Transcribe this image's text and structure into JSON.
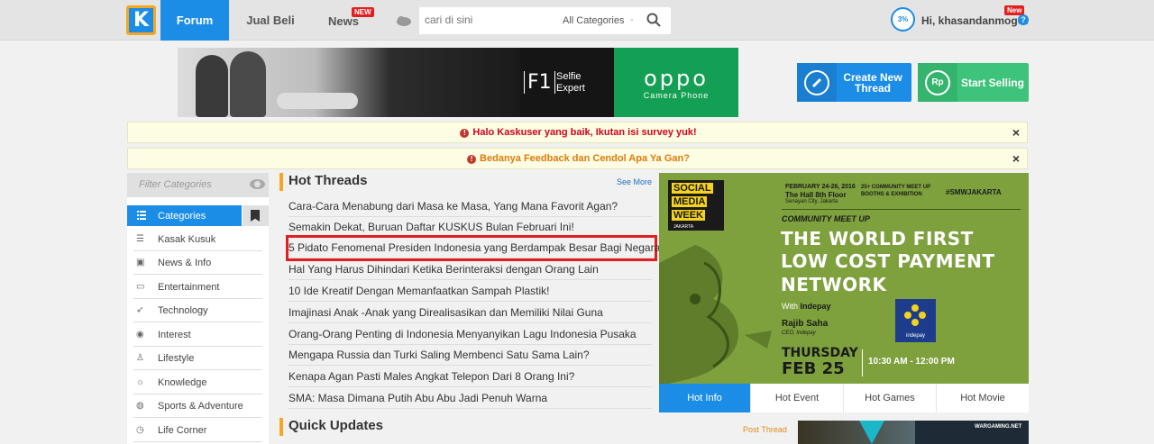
{
  "nav": {
    "logo": "K",
    "tabs": [
      {
        "label": "Forum",
        "active": true
      },
      {
        "label": "Jual Beli",
        "active": false
      },
      {
        "label": "News",
        "badge": "NEW"
      }
    ],
    "search": {
      "placeholder": "cari di sini",
      "category": "All Categories",
      "separator": "-"
    },
    "user": {
      "name": "Hi, khasandanmogot",
      "badge": "New",
      "avatar_text": "3%"
    }
  },
  "banner": {
    "f1": "F1",
    "f1_sub1": "Selfie",
    "f1_sub2": "Expert",
    "brand": "oppo",
    "brand_sub": "Camera Phone"
  },
  "actions": {
    "create_thread": "Create New Thread",
    "start_selling": "Start Selling",
    "rp_icon": "Rp"
  },
  "notices": [
    {
      "text": "Halo Kaskuser yang baik, Ikutan isi survey yuk!",
      "color": "#d0021b"
    },
    {
      "text": "Bedanya Feedback dan Cendol Apa Ya Gan?",
      "color": "#e07a0b"
    }
  ],
  "sidebar": {
    "filter_placeholder": "Filter Categories",
    "categories_label": "Categories",
    "items": [
      {
        "label": "Kasak Kusuk",
        "icon": "chat-icon",
        "glyph": "☰"
      },
      {
        "label": "News & Info",
        "icon": "briefcase-icon",
        "glyph": "▣"
      },
      {
        "label": "Entertainment",
        "icon": "tv-icon",
        "glyph": "▭"
      },
      {
        "label": "Technology",
        "icon": "rocket-icon",
        "glyph": "➶"
      },
      {
        "label": "Interest",
        "icon": "basketball-icon",
        "glyph": "◉"
      },
      {
        "label": "Lifestyle",
        "icon": "dress-icon",
        "glyph": "♙"
      },
      {
        "label": "Knowledge",
        "icon": "lightbulb-icon",
        "glyph": "☼"
      },
      {
        "label": "Sports & Adventure",
        "icon": "soccer-icon",
        "glyph": "◍"
      },
      {
        "label": "Life Corner",
        "icon": "clock-icon",
        "glyph": "◷"
      }
    ]
  },
  "hot_threads": {
    "title": "Hot Threads",
    "see_more": "See More",
    "items": [
      "Cara-Cara Menabung dari Masa ke Masa, Yang Mana Favorit Agan?",
      "Semakin Dekat, Buruan Daftar KUSKUS Bulan Februari Ini!",
      "5 Pidato Fenomenal Presiden Indonesia yang Berdampak Besar Bagi Negara",
      "Hal Yang Harus Dihindari Ketika Berinteraksi dengan Orang Lain",
      "10 Ide Kreatif Dengan Memanfaatkan Sampah Plastik!",
      "Imajinasi Anak -Anak yang Direalisasikan dan Memiliki Nilai Guna",
      "Orang-Orang Penting di Indonesia Menyanyikan Lagu Indonesia Pusaka",
      "Mengapa Russia dan Turki Saling Membenci Satu Sama Lain?",
      "Kenapa Agan Pasti Males Angkat Telepon Dari 8 Orang Ini?",
      "SMA: Masa Dimana Putih Abu Abu Jadi Penuh Warna"
    ],
    "highlighted_index": 2
  },
  "quick_updates": {
    "title": "Quick Updates",
    "post_thread": "Post Thread"
  },
  "event_ad": {
    "smw": [
      "SOCIAL",
      "MEDIA",
      "WEEK"
    ],
    "smw_sub": "JAKARTA",
    "date": "FEBRUARY 24-26, 2016",
    "venue": "The Hall 8th Floor",
    "city": "Senayan City, Jakarta",
    "booths_1": "25+ COMMUNITY MEET UP",
    "booths_2": "BOOTHS & EXHIBITION",
    "hashtag": "#SMWJAKARTA",
    "community": "COMMUNITY MEET UP",
    "headline": [
      "THE WORLD FIRST",
      "LOW COST PAYMENT",
      "NETWORK"
    ],
    "with_label": "With",
    "with_brand": "Indepay",
    "speaker": "Rajib Saha",
    "role": "CEO, Indepay",
    "logo_caption": "indepay",
    "day": "THURSDAY",
    "datebig": "FEB 25",
    "time": "10:30 AM - 12:00 PM"
  },
  "ad_tabs": [
    {
      "label": "Hot Info",
      "active": true
    },
    {
      "label": "Hot Event",
      "active": false
    },
    {
      "label": "Hot Games",
      "active": false
    },
    {
      "label": "Hot Movie",
      "active": false
    }
  ],
  "game_ad": {
    "brand": "WARGAMING.NET"
  },
  "colors": {
    "primary": "#1c8de6",
    "accent": "#f5a623",
    "sell": "#3ec47a",
    "highlight": "#e02020"
  }
}
